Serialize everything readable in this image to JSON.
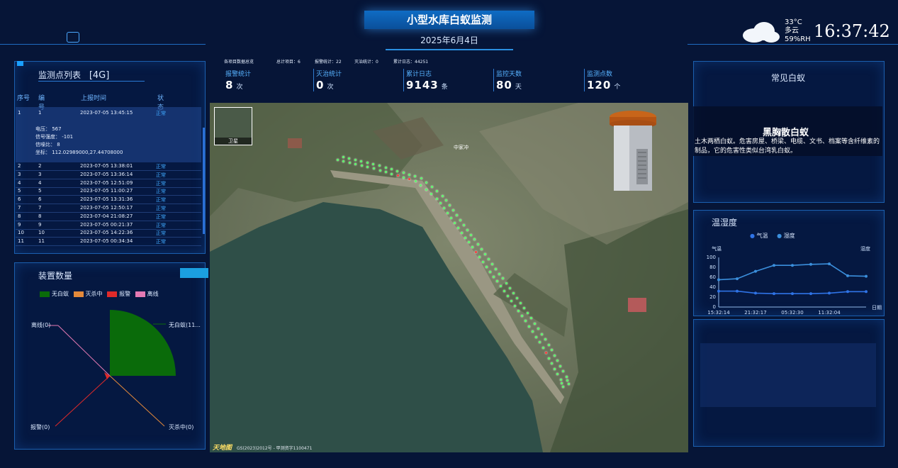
{
  "header": {
    "title": "小型水库白蚁监测",
    "date": "2025年6月4日"
  },
  "weather": {
    "temp": "33°C",
    "condition": "多云",
    "humidity": "59%RH",
    "time": "16:37:42",
    "icon": "cloud-icon"
  },
  "list_panel": {
    "title": "监测点列表",
    "badge": "[4G]",
    "columns": [
      "序号",
      "编号",
      "上报时间",
      "状态"
    ],
    "expanded": {
      "index": "1",
      "code": "1",
      "time": "2023-07-05 13:45:15",
      "status": "正常",
      "voltage": "电压：  567",
      "signal": "信号强度：  -101",
      "snr": "信噪比：  8",
      "coords": "坐标：  112.02989000,27.44708000"
    },
    "rows": [
      {
        "index": "2",
        "code": "2",
        "time": "2023-07-05 13:38:01",
        "status": "正常"
      },
      {
        "index": "3",
        "code": "3",
        "time": "2023-07-05 13:36:14",
        "status": "正常"
      },
      {
        "index": "4",
        "code": "4",
        "time": "2023-07-05 12:51:09",
        "status": "正常"
      },
      {
        "index": "5",
        "code": "5",
        "time": "2023-07-05 11:00:27",
        "status": "正常"
      },
      {
        "index": "6",
        "code": "6",
        "time": "2023-07-05 13:31:36",
        "status": "正常"
      },
      {
        "index": "7",
        "code": "7",
        "time": "2023-07-05 12:50:17",
        "status": "正常"
      },
      {
        "index": "8",
        "code": "8",
        "time": "2023-07-04 21:08:27",
        "status": "正常"
      },
      {
        "index": "9",
        "code": "9",
        "time": "2023-07-05 00:21:37",
        "status": "正常"
      },
      {
        "index": "10",
        "code": "10",
        "time": "2023-07-05 14:22:36",
        "status": "正常"
      },
      {
        "index": "11",
        "code": "11",
        "time": "2023-07-05 00:34:34",
        "status": "正常"
      }
    ]
  },
  "device_panel": {
    "title": "装置数量",
    "legend": [
      {
        "label": "无白蚁",
        "color": "#0a6b0a"
      },
      {
        "label": "灭杀中",
        "color": "#e4893a"
      },
      {
        "label": "报警",
        "color": "#e02a2a"
      },
      {
        "label": "离线",
        "color": "#e57ab4"
      }
    ],
    "labels": {
      "offline": "离线(0)",
      "none": "无白蚁(11...",
      "alarm": "报警(0)",
      "killing": "灭杀中(0)"
    }
  },
  "summary": {
    "heading": "各项目数据总览",
    "items": [
      {
        "label": "总计项目：",
        "value": "6"
      },
      {
        "label": "报警统计：",
        "value": "22"
      },
      {
        "label": "灭治统计：",
        "value": "0"
      },
      {
        "label": "累计日志：",
        "value": "44251"
      }
    ]
  },
  "stats": [
    {
      "label": "报警统计",
      "value": "8",
      "unit": "次"
    },
    {
      "label": "灭治统计",
      "value": "0",
      "unit": "次"
    },
    {
      "label": "累计日志",
      "value": "9143",
      "unit": "条"
    },
    {
      "label": "监控天数",
      "value": "80",
      "unit": "天"
    },
    {
      "label": "监测点数",
      "value": "120",
      "unit": "个"
    }
  ],
  "map": {
    "village": "中家冲",
    "satellite_label": "卫星",
    "logo": "天地图",
    "copyright": "GS(2023)2012号 - 甲测资字1100471"
  },
  "termite_panel": {
    "title": "常见白蚁",
    "name": "黑胸散白蚁",
    "desc": "土木两栖白蚁。危害房屋、桥梁、电缆、文书、档案等含纤维素的制品，它的危害性类似台湾乳白蚁。"
  },
  "temp_panel": {
    "title": "温湿度",
    "legend": [
      "气温",
      "湿度"
    ],
    "left_label": "气温",
    "right_label": "湿度",
    "x_label": "日期"
  },
  "chart_data": {
    "type": "line",
    "x": [
      "15:32:14",
      "",
      "21:32:17",
      "",
      "05:32:30",
      "",
      "11:32:04",
      "",
      ""
    ],
    "x_ticks": [
      "15:32:14",
      "21:32:17",
      "05:32:30",
      "11:32:04"
    ],
    "y_ticks": [
      "0",
      "20",
      "40",
      "60",
      "80",
      "100"
    ],
    "ylim": [
      0,
      100
    ],
    "series": [
      {
        "name": "气温",
        "color": "#2f73e6",
        "values": [
          32,
          32,
          28,
          27,
          27,
          27,
          28,
          31,
          31
        ]
      },
      {
        "name": "湿度",
        "color": "#3b8fdc",
        "values": [
          55,
          57,
          72,
          84,
          84,
          86,
          87,
          63,
          62
        ]
      }
    ],
    "xlabel": "日期",
    "grid": false
  }
}
